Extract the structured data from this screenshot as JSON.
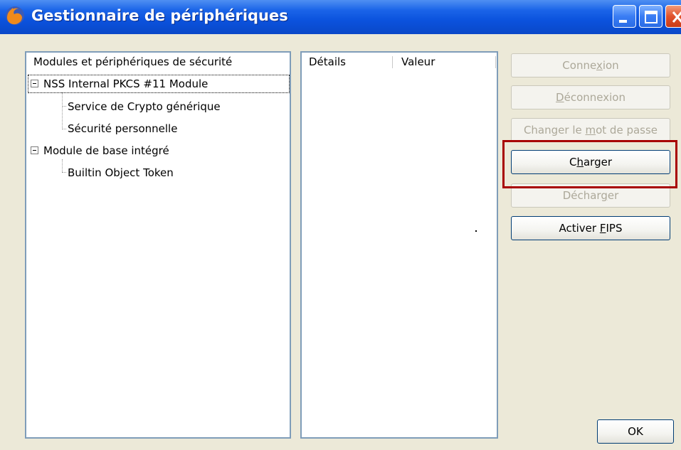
{
  "window": {
    "title": "Gestionnaire de périphériques",
    "icon": "firefox-icon"
  },
  "title_bar_buttons": [
    "minimize",
    "maximize",
    "close"
  ],
  "tree": {
    "header": "Modules et périphériques de sécurité",
    "items": [
      {
        "label": "NSS Internal PKCS #11 Module",
        "expanded": true
      },
      {
        "label": "Service de Crypto générique"
      },
      {
        "label": "Sécurité personnelle"
      },
      {
        "label": "Module de base intégré",
        "expanded": true
      },
      {
        "label": "Builtin Object Token"
      }
    ]
  },
  "details": {
    "columns": [
      "Détails",
      "Valeur"
    ]
  },
  "buttons": {
    "connexion": {
      "before": "Conne",
      "accel": "x",
      "after": "ion",
      "enabled": false
    },
    "deconnexion": {
      "before": "",
      "accel": "D",
      "after": "éconnexion",
      "enabled": false
    },
    "changer_mdp": {
      "before": "Changer le ",
      "accel": "m",
      "after": "ot de passe",
      "enabled": false
    },
    "charger": {
      "before": "C",
      "accel": "h",
      "after": "arger",
      "enabled": true
    },
    "decharger": {
      "before": "Déchar",
      "accel": "g",
      "after": "er",
      "enabled": false
    },
    "activer_fips": {
      "before": "Activer ",
      "accel": "F",
      "after": "IPS",
      "enabled": true
    },
    "ok": {
      "label": "OK",
      "enabled": true
    }
  },
  "colors": {
    "titlebar": "#0b52dd",
    "highlight": "#a80000",
    "dialog_bg": "#ece9d8"
  }
}
